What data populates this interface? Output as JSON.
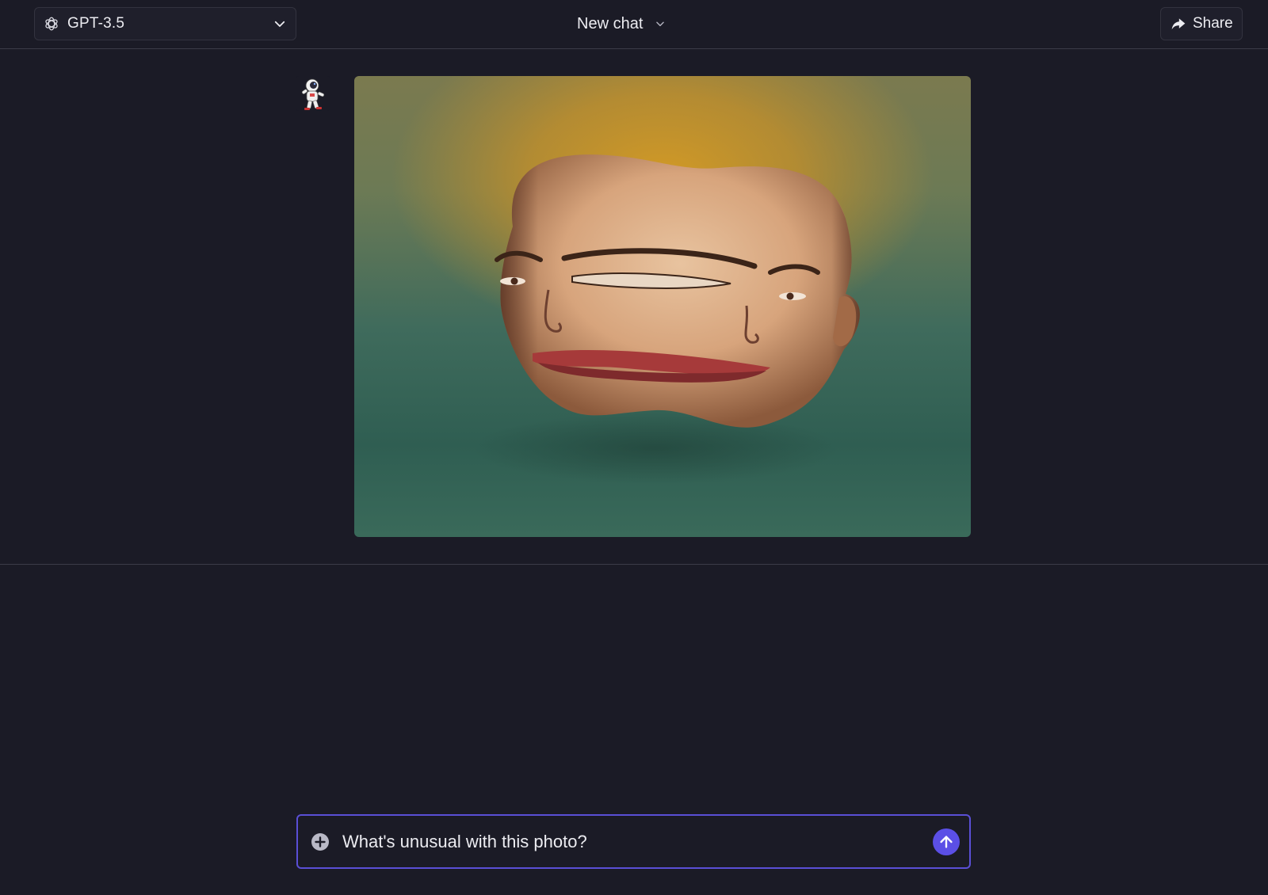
{
  "header": {
    "model_label": "GPT-3.5",
    "chat_title": "New chat",
    "share_label": "Share"
  },
  "icons": {
    "model_logo": "openai-logo-icon",
    "model_chevron": "chevron-down-icon",
    "title_chevron": "chevron-down-icon",
    "share": "share-arrow-icon",
    "attach": "plus-circle-icon",
    "send": "arrow-up-icon"
  },
  "message": {
    "avatar": "astronaut-avatar",
    "attachment": "surreal-painting-image"
  },
  "composer": {
    "value": "What's unusual with this photo?"
  },
  "colors": {
    "background": "#1b1b26",
    "accent": "#5b4fe6",
    "composer_border": "#5a4fd6",
    "divider": "#3b3b48"
  }
}
